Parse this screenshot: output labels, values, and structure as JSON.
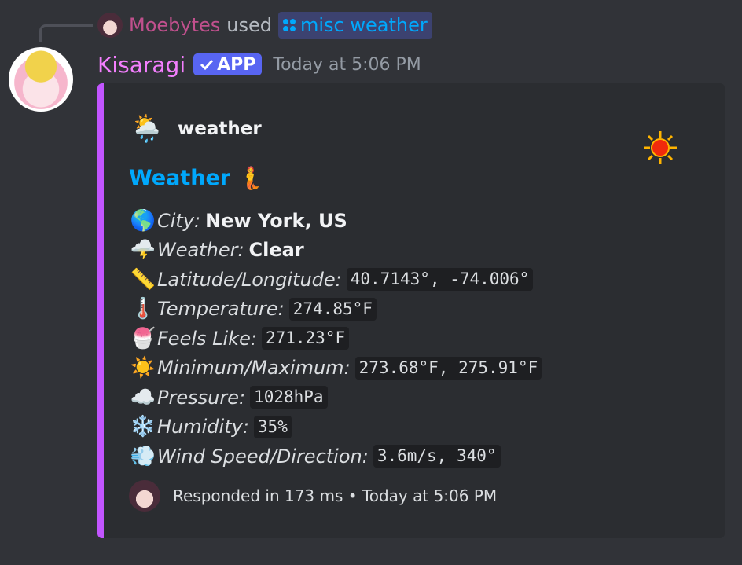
{
  "interaction": {
    "user": "Moebytes",
    "used": "used",
    "command": "misc weather"
  },
  "header": {
    "username": "Kisaragi",
    "badge": "APP",
    "timestamp": "Today at 5:06 PM"
  },
  "embed": {
    "accent_color": "#c255ff",
    "author_icon": "🌦️",
    "author_name": "weather",
    "thumbnail_icon": "sun-icon",
    "title": "Weather",
    "title_emoji": "🧜",
    "fields": [
      {
        "icon": "🌎",
        "icon_name": "globe-icon",
        "label": "City:",
        "value": "New York, US",
        "style": "bold"
      },
      {
        "icon": "🌩️",
        "icon_name": "storm-cloud-icon",
        "label": "Weather:",
        "value": "Clear",
        "style": "bold"
      },
      {
        "icon": "📏",
        "icon_name": "ruler-icon",
        "label": "Latitude/Longitude:",
        "value": "40.7143°, -74.006°",
        "style": "code"
      },
      {
        "icon": "🌡️",
        "icon_name": "thermometer-icon",
        "label": "Temperature:",
        "value": "274.85°F",
        "style": "code"
      },
      {
        "icon": "🍧",
        "icon_name": "shaved-ice-icon",
        "label": "Feels Like:",
        "value": "271.23°F",
        "style": "code"
      },
      {
        "icon": "☀️",
        "icon_name": "sun-icon",
        "label": "Minimum/Maximum:",
        "value": "273.68°F, 275.91°F",
        "style": "code"
      },
      {
        "icon": "☁️",
        "icon_name": "cloud-icon",
        "label": "Pressure:",
        "value": "1028hPa",
        "style": "code"
      },
      {
        "icon": "❄️",
        "icon_name": "snowflake-icon",
        "label": "Humidity:",
        "value": "35%",
        "style": "code"
      },
      {
        "icon": "💨",
        "icon_name": "wind-icon",
        "label": "Wind Speed/Direction:",
        "value": "3.6m/s, 340°",
        "style": "code"
      }
    ],
    "footer": "Responded in 173 ms • Today at 5:06 PM"
  }
}
